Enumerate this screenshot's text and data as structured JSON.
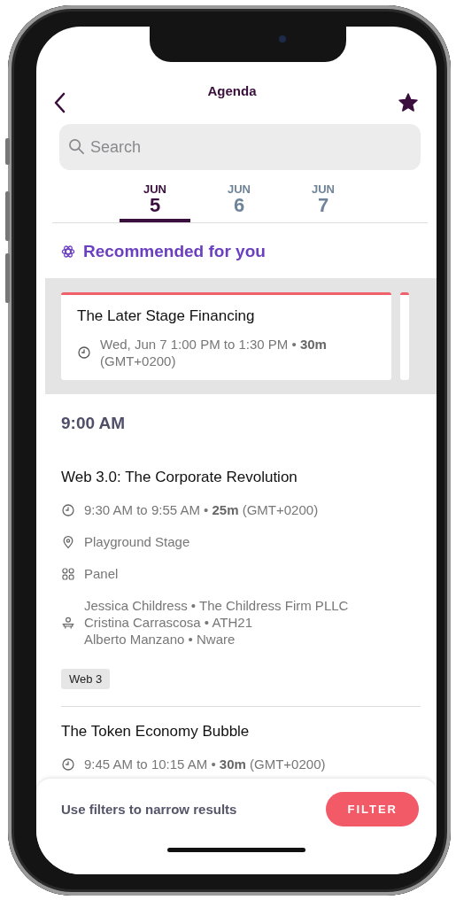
{
  "header": {
    "title": "Agenda"
  },
  "search": {
    "placeholder": "Search"
  },
  "date_tabs": [
    {
      "month": "JUN",
      "day": "5",
      "selected": true
    },
    {
      "month": "JUN",
      "day": "6",
      "selected": false
    },
    {
      "month": "JUN",
      "day": "7",
      "selected": false
    }
  ],
  "recommended": {
    "title": "Recommended for you",
    "cards": [
      {
        "kind": "full",
        "title": "The Later Stage Financing",
        "when": "Wed, Jun 7 1:00 PM to 1:30 PM • **30m** (GMT+0200)"
      },
      {
        "kind": "peek"
      }
    ]
  },
  "sections": [
    {
      "time": "9:00 AM",
      "sessions": [
        {
          "title": "Web 3.0: The Corporate Revolution",
          "details": [
            {
              "kind": "time",
              "lines": [
                "9:30 AM to 9:55 AM • **25m** (GMT+0200)"
              ]
            },
            {
              "kind": "location",
              "lines": [
                "Playground Stage"
              ]
            },
            {
              "kind": "format",
              "lines": [
                "Panel"
              ]
            },
            {
              "kind": "speakers",
              "lines": [
                "Jessica Childress • The Childress Firm PLLC",
                "Cristina Carrascosa • ATH21",
                "Alberto Manzano • Nware"
              ]
            }
          ],
          "tags": [
            "Web 3"
          ]
        },
        {
          "title": "The Token Economy Bubble",
          "details": [
            {
              "kind": "time",
              "lines": [
                "9:45 AM to 10:15 AM • **30m** (GMT+0200)"
              ]
            }
          ]
        }
      ]
    }
  ],
  "filter_bar": {
    "hint": "Use filters to narrow results",
    "button": "FILTER"
  }
}
